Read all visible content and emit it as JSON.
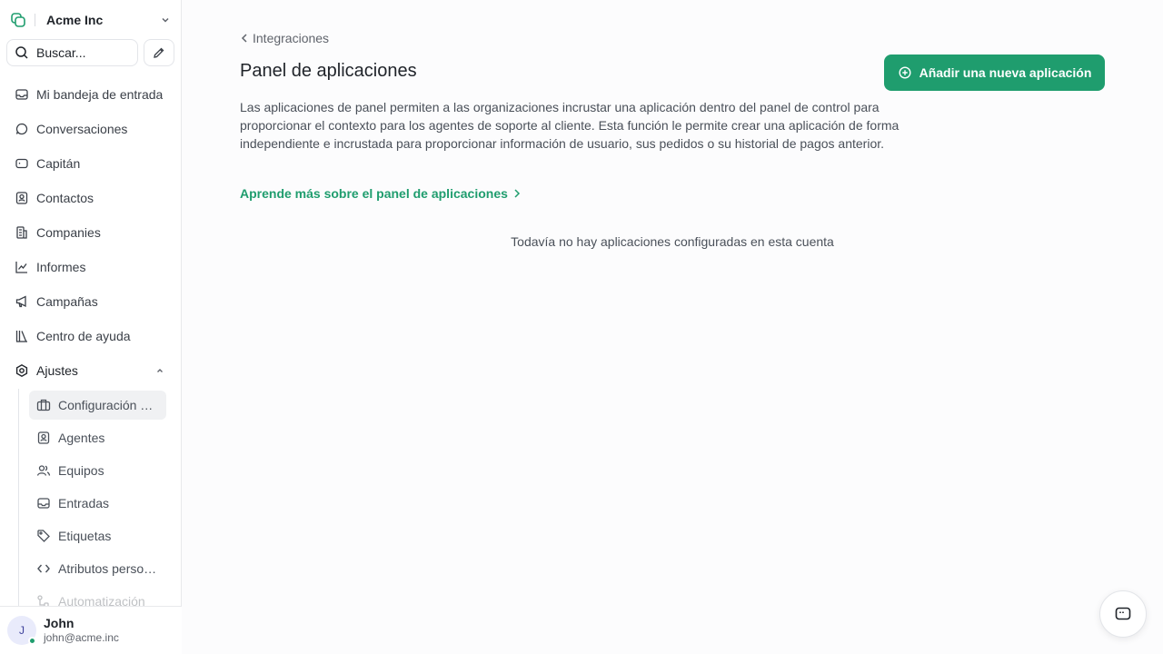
{
  "sidebar": {
    "account_name": "Acme Inc",
    "search_placeholder": "Buscar...",
    "items": [
      {
        "label": "Mi bandeja de entrada",
        "icon": "inbox-icon"
      },
      {
        "label": "Conversaciones",
        "icon": "chat-bubble-icon"
      },
      {
        "label": "Capitán",
        "icon": "bot-icon"
      },
      {
        "label": "Contactos",
        "icon": "contact-card-icon"
      },
      {
        "label": "Companies",
        "icon": "building-icon"
      },
      {
        "label": "Informes",
        "icon": "line-chart-icon"
      },
      {
        "label": "Campañas",
        "icon": "megaphone-icon"
      },
      {
        "label": "Centro de ayuda",
        "icon": "library-icon"
      },
      {
        "label": "Ajustes",
        "icon": "settings-icon"
      }
    ],
    "settings_items": [
      {
        "label": "Configuración de la cuenta",
        "icon": "briefcase-icon"
      },
      {
        "label": "Agentes",
        "icon": "agent-icon"
      },
      {
        "label": "Equipos",
        "icon": "users-icon"
      },
      {
        "label": "Entradas",
        "icon": "inbox-tray-icon"
      },
      {
        "label": "Etiquetas",
        "icon": "tag-icon"
      },
      {
        "label": "Atributos personalizados",
        "icon": "code-icon"
      },
      {
        "label": "Automatización",
        "icon": "automation-icon"
      }
    ]
  },
  "user": {
    "initial": "J",
    "name": "John",
    "email": "john@acme.inc"
  },
  "main": {
    "back_label": "Integraciones",
    "title": "Panel de aplicaciones",
    "add_button_label": "Añadir una nueva aplicación",
    "description": "Las aplicaciones de panel permiten a las organizaciones incrustar una aplicación dentro del panel de control para proporcionar el contexto para los agentes de soporte al cliente. Esta función le permite crear una aplicación de forma independiente e incrustada para proporcionar información de usuario, sus pedidos o su historial de pagos anterior.",
    "learn_more_label": "Aprende más sobre el panel de aplicaciones",
    "empty_message": "Todavía no hay aplicaciones configuradas en esta cuenta"
  },
  "colors": {
    "accent": "#1f9d6e",
    "background": "#fcfcfd",
    "sidebar_bg": "#ffffff"
  }
}
